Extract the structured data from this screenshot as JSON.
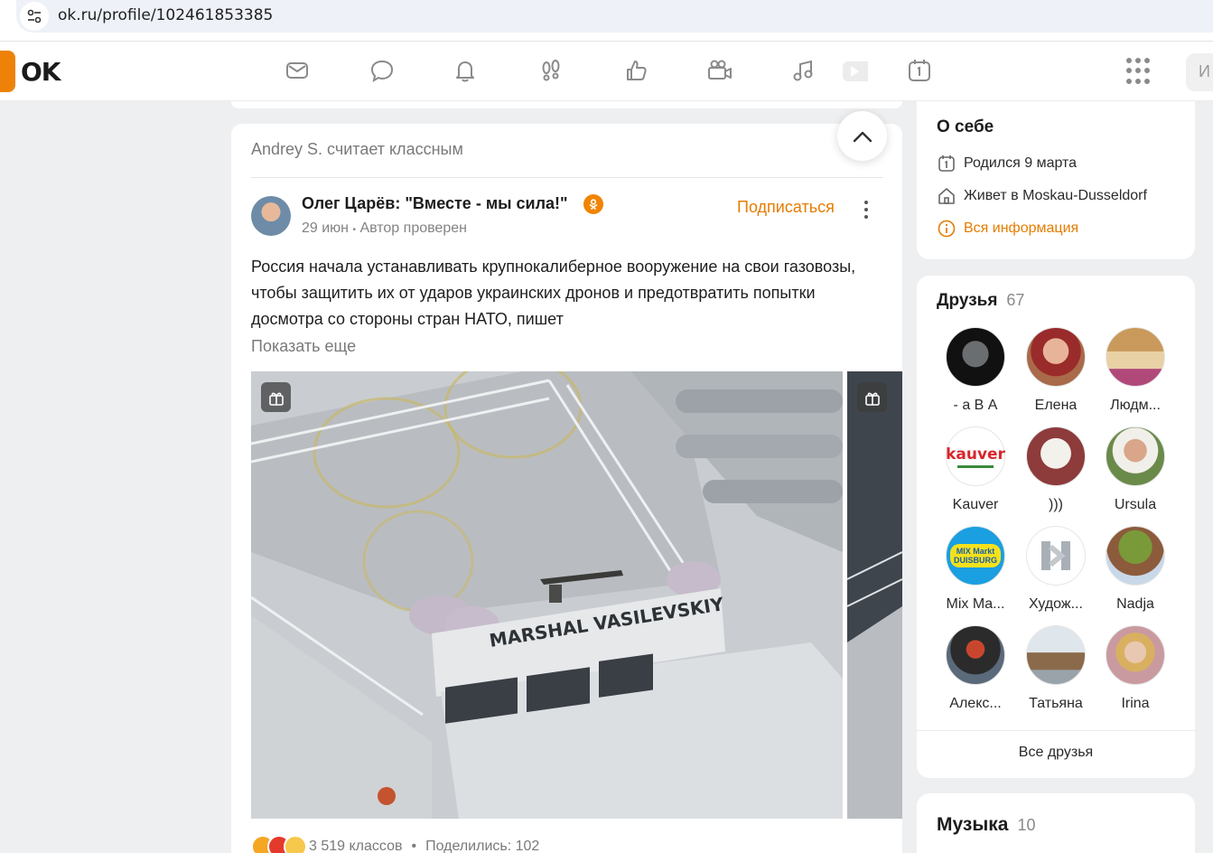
{
  "browser": {
    "url": "ok.ru/profile/102461853385",
    "site_info_icon": "tune-icon"
  },
  "topnav": {
    "logo_text": "OK",
    "icons": [
      "mail-icon",
      "chat-bubble-icon",
      "bell-icon",
      "footprints-icon",
      "thumbs-up-icon",
      "video-camera-icon",
      "music-note-icon",
      "play-icon",
      "calendar-icon"
    ],
    "search_stub": "И"
  },
  "post": {
    "liked_by": "Andrey S. считает классным",
    "author": "Олег Царёв: \"Вместе - мы сила!\"",
    "date": "29 июн",
    "meta_sep": "•",
    "verified_label": "Автор проверен",
    "subscribe_label": "Подписаться",
    "text": "Россия начала устанавливать крупнокалиберное вооружение на свои газовозы, чтобы защитить их от ударов украинских дронов и предотвратить попытки досмотра со стороны стран НАТО, пишет",
    "show_more": "Показать еще",
    "image_caption": "MARSHAL VASILEVSKIY",
    "likes": "3 519 классов",
    "shares_sep": "•",
    "shares": "Поделились: 102"
  },
  "about": {
    "title": "О себе",
    "born": "Родился 9 марта",
    "lives": "Живет в Moskau-Dusseldorf",
    "all_info": "Вся информация"
  },
  "friends": {
    "title": "Друзья",
    "count": "67",
    "items": [
      {
        "name": "- а В А"
      },
      {
        "name": "Елена"
      },
      {
        "name": "Людм..."
      },
      {
        "name": "Kauver"
      },
      {
        "name": ")))"
      },
      {
        "name": "Ursula"
      },
      {
        "name": "Mix Ma..."
      },
      {
        "name": "Худож..."
      },
      {
        "name": "Nadja"
      },
      {
        "name": "Алекс..."
      },
      {
        "name": "Татьяна"
      },
      {
        "name": "Irina"
      }
    ],
    "all_label": "Все друзья",
    "logo_kauver": "kauver",
    "logo_mix": "MIX Markt DUISBURG"
  },
  "music": {
    "title": "Музыка",
    "count": "10"
  },
  "colors": {
    "accent": "#ee8208",
    "link": "#e57c00"
  }
}
